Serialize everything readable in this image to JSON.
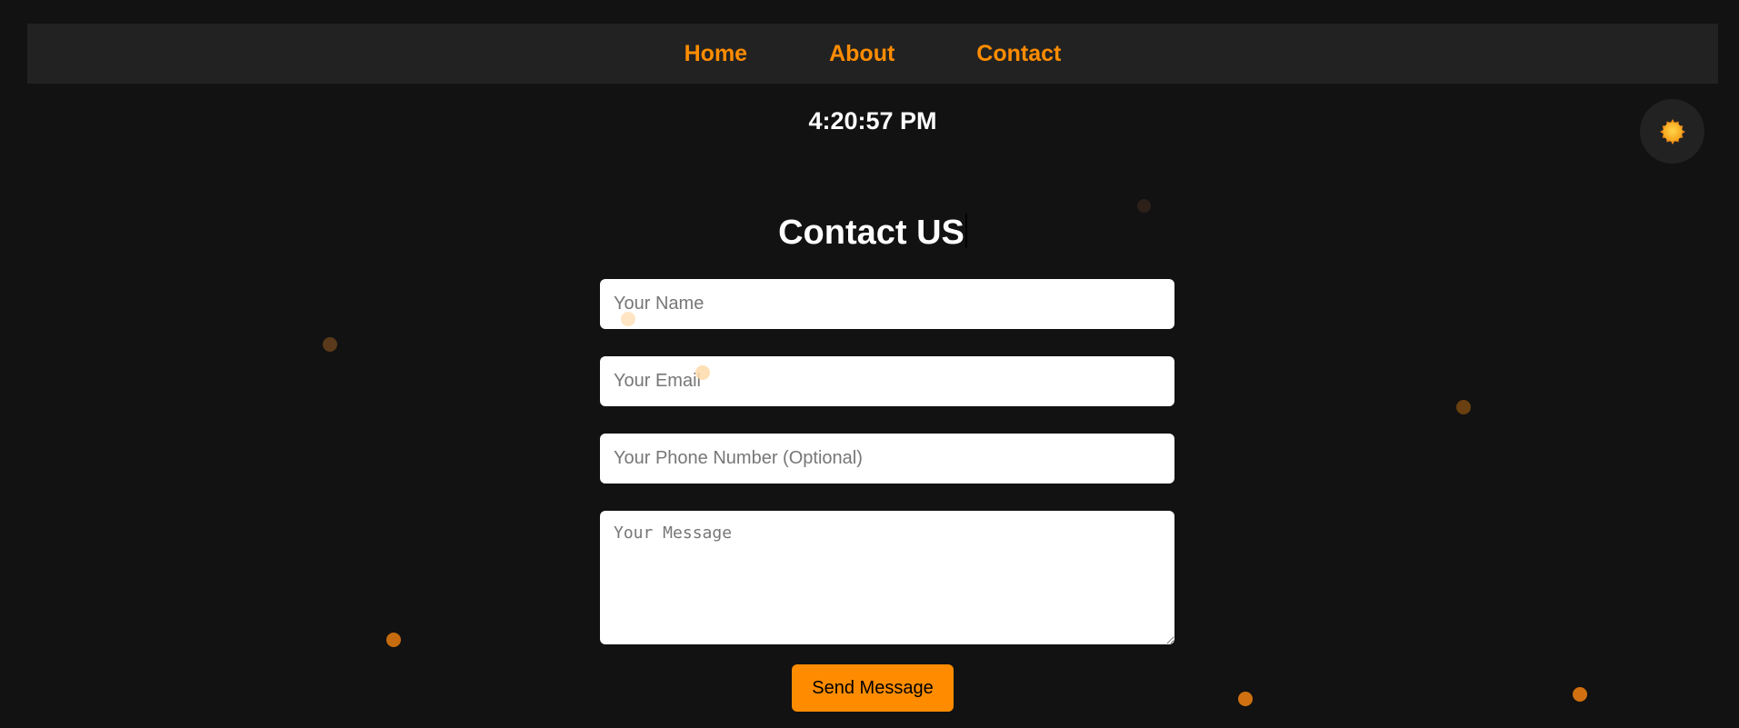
{
  "nav": {
    "links": [
      {
        "label": "Home"
      },
      {
        "label": "About"
      },
      {
        "label": "Contact"
      }
    ]
  },
  "clock": {
    "time": "4:20:57 PM"
  },
  "theme_toggle": {
    "icon": "sun-icon"
  },
  "contact": {
    "title": "Contact US",
    "name_placeholder": "Your Name",
    "email_placeholder": "Your Email",
    "phone_placeholder": "Your Phone Number (Optional)",
    "message_placeholder": "Your Message",
    "name_value": "",
    "email_value": "",
    "phone_value": "",
    "message_value": "",
    "send_label": "Send Message"
  },
  "colors": {
    "accent": "#ff8c00",
    "background": "#121212",
    "navbar": "#222222",
    "text": "#ffffff"
  }
}
